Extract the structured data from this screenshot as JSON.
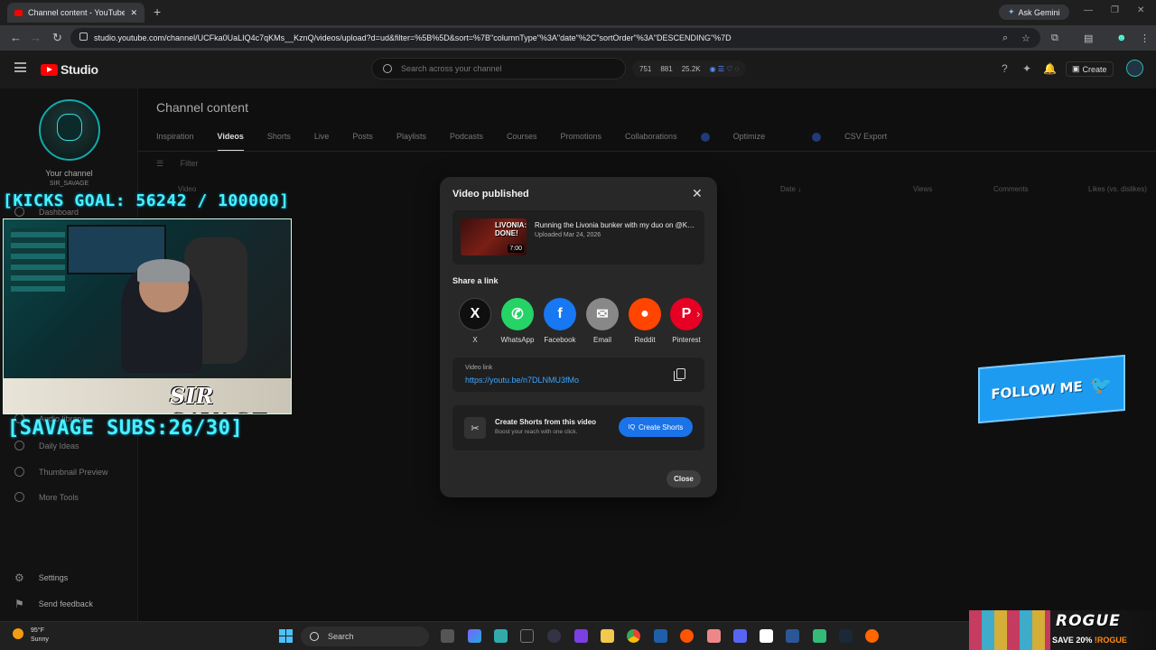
{
  "browser": {
    "tab_title": "Channel content - YouTube Studio",
    "ask_gemini": "Ask Gemini",
    "url": "studio.youtube.com/channel/UCFka0UaLIQ4c7qKMs__KznQ/videos/upload?d=ud&filter=%5B%5D&sort=%7B\"columnType\"%3A\"date\"%2C\"sortOrder\"%3A\"DESCENDING\"%7D"
  },
  "header": {
    "logo_text": "Studio",
    "search_placeholder": "Search across your channel",
    "stats": [
      "751",
      "881",
      "25.2K"
    ],
    "create_label": "Create"
  },
  "sidebar": {
    "your_channel": "Your channel",
    "channel_handle": "SIR_SAVAGE",
    "items": [
      {
        "label": "Dashboard"
      },
      {
        "label": "Audio library"
      },
      {
        "label": "Daily Ideas"
      },
      {
        "label": "Thumbnail Preview"
      },
      {
        "label": "More Tools"
      }
    ],
    "settings": "Settings",
    "feedback": "Send feedback"
  },
  "main": {
    "title": "Channel content",
    "tabs": [
      "Inspiration",
      "Videos",
      "Shorts",
      "Live",
      "Posts",
      "Playlists",
      "Podcasts",
      "Courses",
      "Promotions",
      "Collaborations",
      "Optimize",
      "CSV Export"
    ],
    "active_tab": "Videos",
    "filter": "Filter",
    "columns": {
      "video": "Video",
      "date": "Date ↓",
      "views": "Views",
      "comments": "Comments",
      "likes": "Likes (vs. dislikes)"
    }
  },
  "overlay": {
    "kicks_goal": "[KICKS GOAL: 56242 / 100000]",
    "savage_subs": "[SAVAGE SUBS:26/30]",
    "cam_signature": "SIR SAVAGE",
    "follow_me": "FOLLOW ME"
  },
  "modal": {
    "title": "Video published",
    "video_title": "Running the Livonia bunker with my duo on @Kar…",
    "upload_date": "Uploaded Mar 24, 2026",
    "thumb_text": "LIVONIA: DONE!",
    "duration": "7:00",
    "share_label": "Share a link",
    "share": [
      {
        "name": "X",
        "glyph": "X",
        "color": "#0f0f0f"
      },
      {
        "name": "WhatsApp",
        "glyph": "✆",
        "color": "#25d366"
      },
      {
        "name": "Facebook",
        "glyph": "f",
        "color": "#1877f2"
      },
      {
        "name": "Email",
        "glyph": "✉",
        "color": "#888888"
      },
      {
        "name": "Reddit",
        "glyph": "●",
        "color": "#ff4500"
      },
      {
        "name": "Pinterest",
        "glyph": "P",
        "color": "#e60023"
      }
    ],
    "link_label": "Video link",
    "link_url": "https://youtu.be/n7DLNMU3fMo",
    "shorts_title": "Create Shorts from this video",
    "shorts_sub": "Boost your reach with one click.",
    "shorts_button": "Create Shorts",
    "close": "Close"
  },
  "taskbar": {
    "temp": "95°F",
    "weather": "Sunny",
    "search": "Search"
  },
  "promo": {
    "brand": "ROGUE",
    "save_text": "SAVE 20%",
    "code": "!ROGUE"
  }
}
